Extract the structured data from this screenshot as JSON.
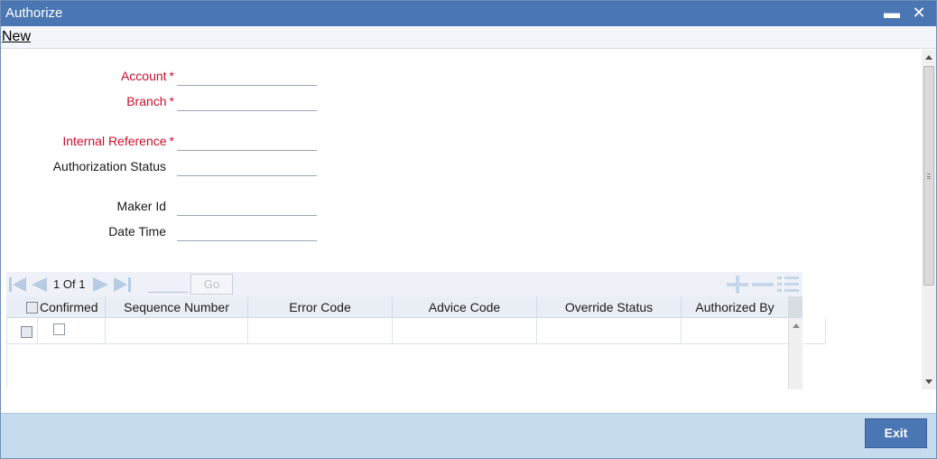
{
  "window": {
    "title": "Authorize",
    "minimize_glyph": "▬",
    "close_glyph": "✕"
  },
  "menu": {
    "new_label": "New"
  },
  "form": {
    "account": {
      "label": "Account",
      "value": "",
      "required": true
    },
    "branch": {
      "label": "Branch",
      "value": "",
      "required": true
    },
    "internal_reference": {
      "label": "Internal Reference",
      "value": "",
      "required": true
    },
    "authorization_status": {
      "label": "Authorization Status",
      "value": "",
      "required": false
    },
    "maker_id": {
      "label": "Maker Id",
      "value": "",
      "required": false
    },
    "date_time": {
      "label": "Date Time",
      "value": "",
      "required": false
    },
    "required_marker": "*"
  },
  "grid": {
    "pagination": {
      "current": "1",
      "of_label": "Of",
      "total": "1",
      "page_input": "",
      "go_label": "Go"
    },
    "columns": [
      "Confirmed",
      "Sequence Number",
      "Error Code",
      "Advice Code",
      "Override Status",
      "Authorized By"
    ],
    "rows": [
      {
        "selected": false,
        "confirmed": false,
        "sequence_number": "",
        "error_code": "",
        "advice_code": "",
        "override_status": "",
        "authorized_by": ""
      }
    ]
  },
  "footer": {
    "exit_label": "Exit"
  },
  "colors": {
    "title_bar": "#4a76b3",
    "required_label": "#c8102e",
    "footer": "#c5dcef",
    "exit_button": "#4a76b3"
  }
}
